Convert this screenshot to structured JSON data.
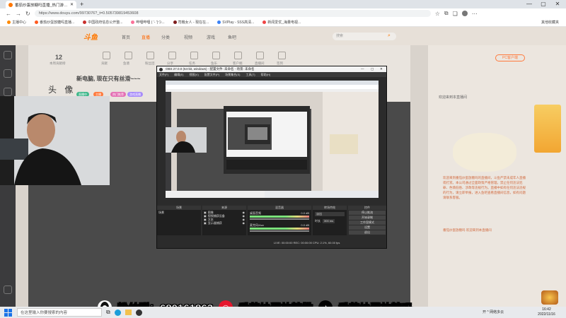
{
  "browser": {
    "tab_title": "番茄炒蛋放糖吗直播_热门游戏直播_斗鱼直播",
    "new_tab": "+",
    "url": "https://www.douyu.com/9973076?_t=0.505739819453608",
    "bookmarks": [
      {
        "label": "主播中心",
        "color": "#ff8a00"
      },
      {
        "label": "番茄炒蛋放糖吗直播...",
        "color": "#ff5a1f"
      },
      {
        "label": "中国政府信息公开整...",
        "color": "#c9302c"
      },
      {
        "label": "哔哩哔哩 ( '- ')つ...",
        "color": "#fb7299"
      },
      {
        "label": "司機女人 - 現在在...",
        "color": "#7f1d1d"
      },
      {
        "label": "SVPlay - SSS高清...",
        "color": "#3b82f6"
      },
      {
        "label": "新闻爱优_海量电视...",
        "color": "#ef4444"
      }
    ],
    "bookmark_other": "其他收藏夹"
  },
  "site": {
    "logo": "斗鱼",
    "nav": [
      "首页",
      "直播",
      "分类",
      "视频",
      "游戏",
      "鱼吧"
    ],
    "active_nav": "直播",
    "search_placeholder": "搜索",
    "pc_badge": "PC客户端"
  },
  "room": {
    "rank": "12",
    "rank_sub": "本周贡献榜",
    "icons": [
      "贡献",
      "鱼塘",
      "粉丝团",
      "分享",
      "任务",
      "鱼乐",
      "客户端",
      "直播间",
      "签到"
    ],
    "title": "新电脑, 现在只有丝滑~~~",
    "anchor": "头  像",
    "tags": [
      {
        "label": "直播中",
        "color": "#40b88c"
      },
      {
        "label": "主播",
        "color": "#ff7a3d"
      },
      {
        "label": "热门推荐",
        "color": "#e46fb4"
      },
      {
        "label": "游戏直播",
        "color": "#a78bfa"
      }
    ]
  },
  "chat": {
    "header": "欢迎来到本直播间",
    "notice": "欢迎来到番茄炒蛋放糖吗的直播间，斗鱼严禁未成年人直播或打赏。本公司通过全面政策严格管理，禁止任何违法犯罪、色情低俗、涉政等违规行为。直播中如有任何违法违规的行为，请立即举报，进入鱼吧查看直播间信息，如有问题请联系客服。",
    "follow": "番茄炒蛋放糖吗 欢迎来到本直播间"
  },
  "obs": {
    "title": "OBS 27.0.0 (64-bit, windows) - 配置文件: 未命名 - 场景: 未命名",
    "menu": [
      "文件(F)",
      "编辑(E)",
      "视图(V)",
      "配置文件(P)",
      "场景集合(S)",
      "工具(T)",
      "帮助(H)"
    ],
    "docks": {
      "scenes": "场景",
      "sources": "来源",
      "mixer": "混音器",
      "transitions": "转场特效",
      "controls": "控件"
    },
    "scenes": [
      "场景"
    ],
    "sources": [
      "图像",
      "视频捕获设备",
      "文本",
      "显示器捕获"
    ],
    "mixer": [
      {
        "name": "桌面音频",
        "db": "0.0 dB"
      },
      {
        "name": "麦克风/Aux",
        "db": "0.0 dB"
      }
    ],
    "transition": {
      "type": "淡出",
      "duration_label": "时长",
      "duration": "300 ms"
    },
    "controls": [
      "停止推流",
      "开始录制",
      "工作室模式",
      "设置",
      "退出"
    ],
    "status": "LIVE: 00:00:00   REC: 00:00:00   CPU: 2.1%, 60.00 fps"
  },
  "overlay": {
    "fan_group": "粉丝群：680161863",
    "weibo_name": "番茄炒蛋放糖撒",
    "tiktok_name": "番茄炒蛋放糖吗",
    "colors": {
      "weibo": "#e6162d",
      "tiktok": "#000000",
      "qq": "#111111"
    }
  },
  "taskbar": {
    "search_placeholder": "在这里输入你要搜索的内容",
    "tray": "开 ^ 网络多云",
    "time": "16:42",
    "date": "2022/11/16"
  }
}
